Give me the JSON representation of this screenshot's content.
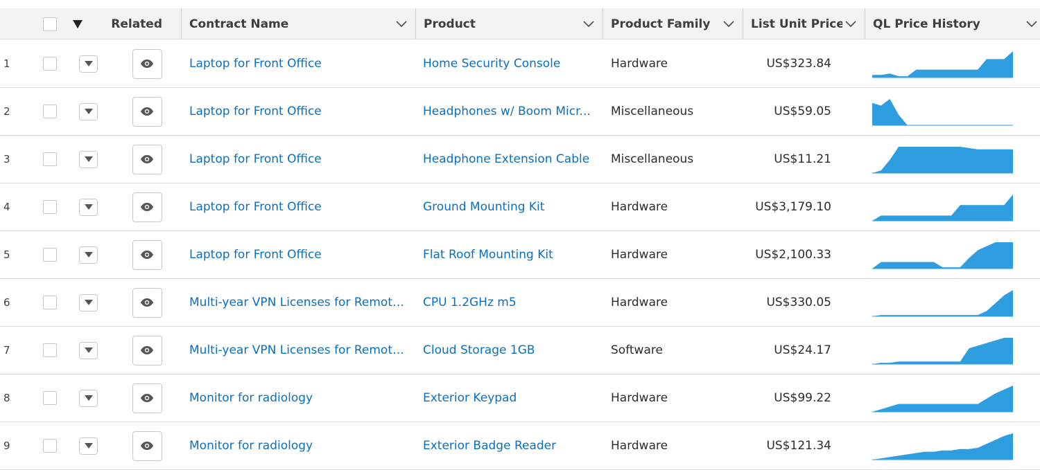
{
  "columns": {
    "related": "Related",
    "contract_name": "Contract Name",
    "product": "Product",
    "product_family": "Product Family",
    "list_unit_price": "List Unit Price",
    "price_history": "QL Price History"
  },
  "icons": {
    "chevron": "chevron-down-icon",
    "caret": "caret-down-icon",
    "eye": "eye-icon"
  },
  "colors": {
    "link": "#0b6fbf",
    "sparkline": "#2f9ee0",
    "header_bg": "#f3f3f3"
  },
  "rows": [
    {
      "num": "1",
      "contract": "Laptop for Front Office",
      "product": "Home Security Console",
      "family": "Hardware",
      "price": "US$323.84",
      "history": [
        0.1,
        0.1,
        0.15,
        0.05,
        0.05,
        0.3,
        0.3,
        0.3,
        0.3,
        0.3,
        0.3,
        0.3,
        0.3,
        0.7,
        0.7,
        0.7,
        1.0
      ]
    },
    {
      "num": "2",
      "contract": "Laptop for Front Office",
      "product": "Headphones w/ Boom Micr...",
      "family": "Miscellaneous",
      "price": "US$59.05",
      "history": [
        0.85,
        0.75,
        1.0,
        0.4,
        0.0,
        0.0,
        0.0,
        0.0,
        0.0,
        0.0,
        0.0,
        0.0,
        0.0,
        0.0,
        0.0,
        0.0,
        0.0
      ]
    },
    {
      "num": "3",
      "contract": "Laptop for Front Office",
      "product": "Headphone Extension Cable",
      "family": "Miscellaneous",
      "price": "US$11.21",
      "history": [
        0.0,
        0.1,
        0.5,
        1.0,
        1.0,
        1.0,
        1.0,
        1.0,
        1.0,
        1.0,
        1.0,
        0.95,
        0.9,
        0.9,
        0.9,
        0.9,
        0.9
      ]
    },
    {
      "num": "4",
      "contract": "Laptop for Front Office",
      "product": "Ground Mounting Kit",
      "family": "Hardware",
      "price": "US$3,179.10",
      "history": [
        0.0,
        0.2,
        0.2,
        0.2,
        0.2,
        0.2,
        0.2,
        0.2,
        0.2,
        0.2,
        0.6,
        0.6,
        0.6,
        0.6,
        0.6,
        0.6,
        1.0
      ]
    },
    {
      "num": "5",
      "contract": "Laptop for Front Office",
      "product": "Flat Roof Mounting Kit",
      "family": "Hardware",
      "price": "US$2,100.33",
      "history": [
        0.0,
        0.25,
        0.25,
        0.25,
        0.25,
        0.25,
        0.25,
        0.25,
        0.05,
        0.05,
        0.05,
        0.4,
        0.7,
        0.85,
        1.0,
        1.0,
        1.0
      ]
    },
    {
      "num": "6",
      "contract": "Multi-year VPN Licenses for Remote...",
      "product": "CPU 1.2GHz m5",
      "family": "Hardware",
      "price": "US$330.05",
      "history": [
        0.0,
        0.05,
        0.05,
        0.05,
        0.05,
        0.05,
        0.05,
        0.05,
        0.05,
        0.05,
        0.05,
        0.05,
        0.05,
        0.2,
        0.5,
        0.8,
        1.0
      ]
    },
    {
      "num": "7",
      "contract": "Multi-year VPN Licenses for Remote...",
      "product": "Cloud Storage 1GB",
      "family": "Software",
      "price": "US$24.17",
      "history": [
        0.0,
        0.05,
        0.05,
        0.1,
        0.1,
        0.1,
        0.1,
        0.1,
        0.1,
        0.1,
        0.1,
        0.6,
        0.7,
        0.8,
        0.9,
        1.0,
        1.0
      ]
    },
    {
      "num": "8",
      "contract": "Monitor for radiology",
      "product": "Exterior Keypad",
      "family": "Hardware",
      "price": "US$99.22",
      "history": [
        0.0,
        0.1,
        0.2,
        0.3,
        0.3,
        0.3,
        0.3,
        0.3,
        0.3,
        0.3,
        0.3,
        0.3,
        0.3,
        0.5,
        0.7,
        0.85,
        1.0
      ]
    },
    {
      "num": "9",
      "contract": "Monitor for radiology",
      "product": "Exterior Badge Reader",
      "family": "Hardware",
      "price": "US$121.34",
      "history": [
        0.0,
        0.05,
        0.1,
        0.15,
        0.2,
        0.25,
        0.3,
        0.3,
        0.35,
        0.35,
        0.4,
        0.4,
        0.45,
        0.6,
        0.75,
        0.9,
        1.0
      ]
    }
  ]
}
